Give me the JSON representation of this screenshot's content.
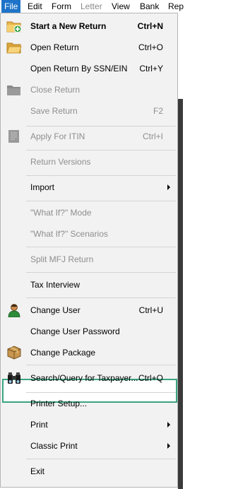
{
  "menubar": {
    "items": [
      "File",
      "Edit",
      "Form",
      "Letter",
      "View",
      "Bank",
      "Rep"
    ],
    "active": "File"
  },
  "menu": {
    "items": [
      {
        "label": "Start a New Return",
        "shortcut": "Ctrl+N",
        "icon": "new-folder-icon",
        "bold": true
      },
      {
        "label": "Open Return",
        "shortcut": "Ctrl+O",
        "icon": "open-folder-icon"
      },
      {
        "label": "Open Return By SSN/EIN",
        "shortcut": "Ctrl+Y"
      },
      {
        "label": "Close Return",
        "icon": "closed-folder-icon",
        "disabled": true
      },
      {
        "label": "Save Return",
        "shortcut": "F2",
        "disabled": true
      },
      {
        "label": "Apply For ITIN",
        "shortcut": "Ctrl+I",
        "icon": "document-icon",
        "disabled": true
      },
      {
        "label": "Return Versions",
        "disabled": true
      },
      {
        "label": "Import",
        "submenu": true
      },
      {
        "label": "\"What If?\" Mode",
        "disabled": true
      },
      {
        "label": "\"What If?\" Scenarios",
        "disabled": true
      },
      {
        "label": "Split MFJ Return",
        "disabled": true
      },
      {
        "label": "Tax Interview"
      },
      {
        "label": "Change User",
        "shortcut": "Ctrl+U",
        "icon": "user-icon"
      },
      {
        "label": "Change User Password"
      },
      {
        "label": "Change Package",
        "icon": "package-icon"
      },
      {
        "label": "Search/Query for Taxpayer...",
        "shortcut": "Ctrl+Q",
        "icon": "binoculars-icon",
        "highlighted": true
      },
      {
        "label": "Printer Setup..."
      },
      {
        "label": "Print",
        "submenu": true
      },
      {
        "label": "Classic Print",
        "submenu": true
      },
      {
        "label": "Exit"
      }
    ]
  },
  "colors": {
    "menubar_active": "#1e73c9",
    "highlight_border": "#3aa57e",
    "disabled_text": "#8e8e8e"
  }
}
